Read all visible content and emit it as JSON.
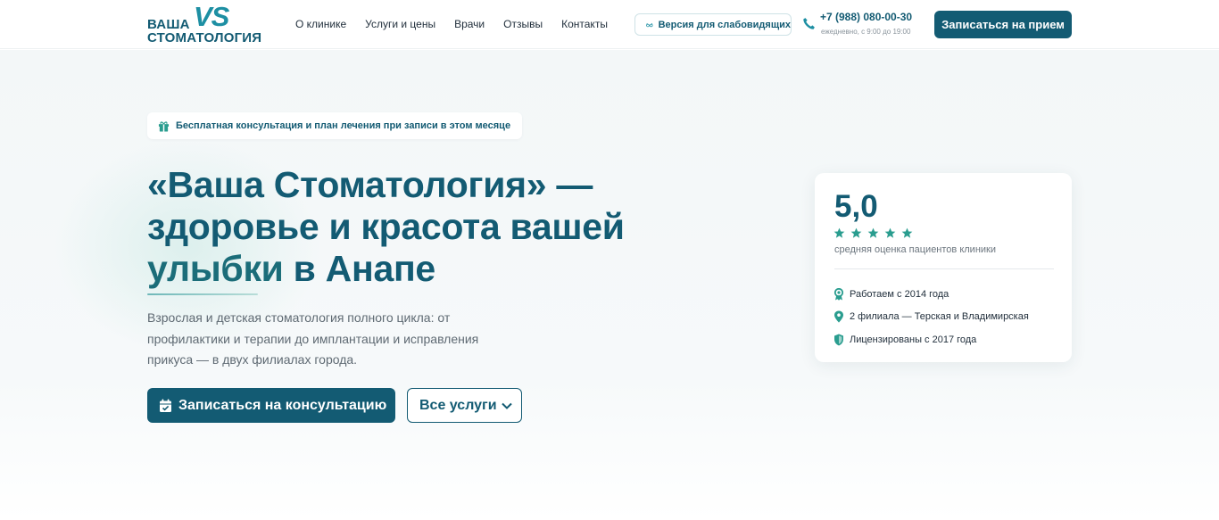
{
  "brand": {
    "logo_line1": "ВАША",
    "logo_line2": "СТОМАТОЛОГИЯ",
    "logo_mark": "VS",
    "primary_color": "#135b73",
    "accent_color": "#1d8fa3"
  },
  "nav": {
    "items": [
      {
        "label": "О клинике"
      },
      {
        "label": "Услуги и цены"
      },
      {
        "label": "Врачи"
      },
      {
        "label": "Отзывы"
      },
      {
        "label": "Контакты"
      }
    ]
  },
  "header": {
    "a11y_label": "Версия для слабовидящих",
    "a11y_icon": "glasses-icon",
    "phone": "+7 (988) 080-00-30",
    "phone_icon": "phone-icon",
    "hours": "ежедневно, с 9:00 до 19:00",
    "cta_label": "Записаться на прием"
  },
  "hero": {
    "promo_icon": "gift-icon",
    "promo_text": "Бесплатная консультация и план лечения при записи в этом месяце",
    "title_part1": "«Ваша Стоматология» — здоровье и красота вашей",
    "title_highlight": "улыбки",
    "title_part2": "в Анапе",
    "lead": "Взрослая и детская стоматология полного цикла: от профилактики и терапии до имплантации и исправления прикуса — в двух филиалах города.",
    "primary_button": "Записаться на консультацию",
    "primary_button_icon": "calendar-check-icon",
    "secondary_button": "Все услуги",
    "secondary_button_icon": "chevron-down-icon"
  },
  "rating_card": {
    "score": "5,0",
    "stars": 5,
    "max_stars": 5,
    "star_color": "#2a9d8f",
    "caption": "средняя оценка пациентов клиники",
    "facts": [
      {
        "icon": "award-icon",
        "text": "Работаем с 2014 года"
      },
      {
        "icon": "map-pin-icon",
        "text": "2 филиала — Терская и Владимирская"
      },
      {
        "icon": "shield-icon",
        "text": "Лицензированы с 2017 года"
      }
    ]
  }
}
